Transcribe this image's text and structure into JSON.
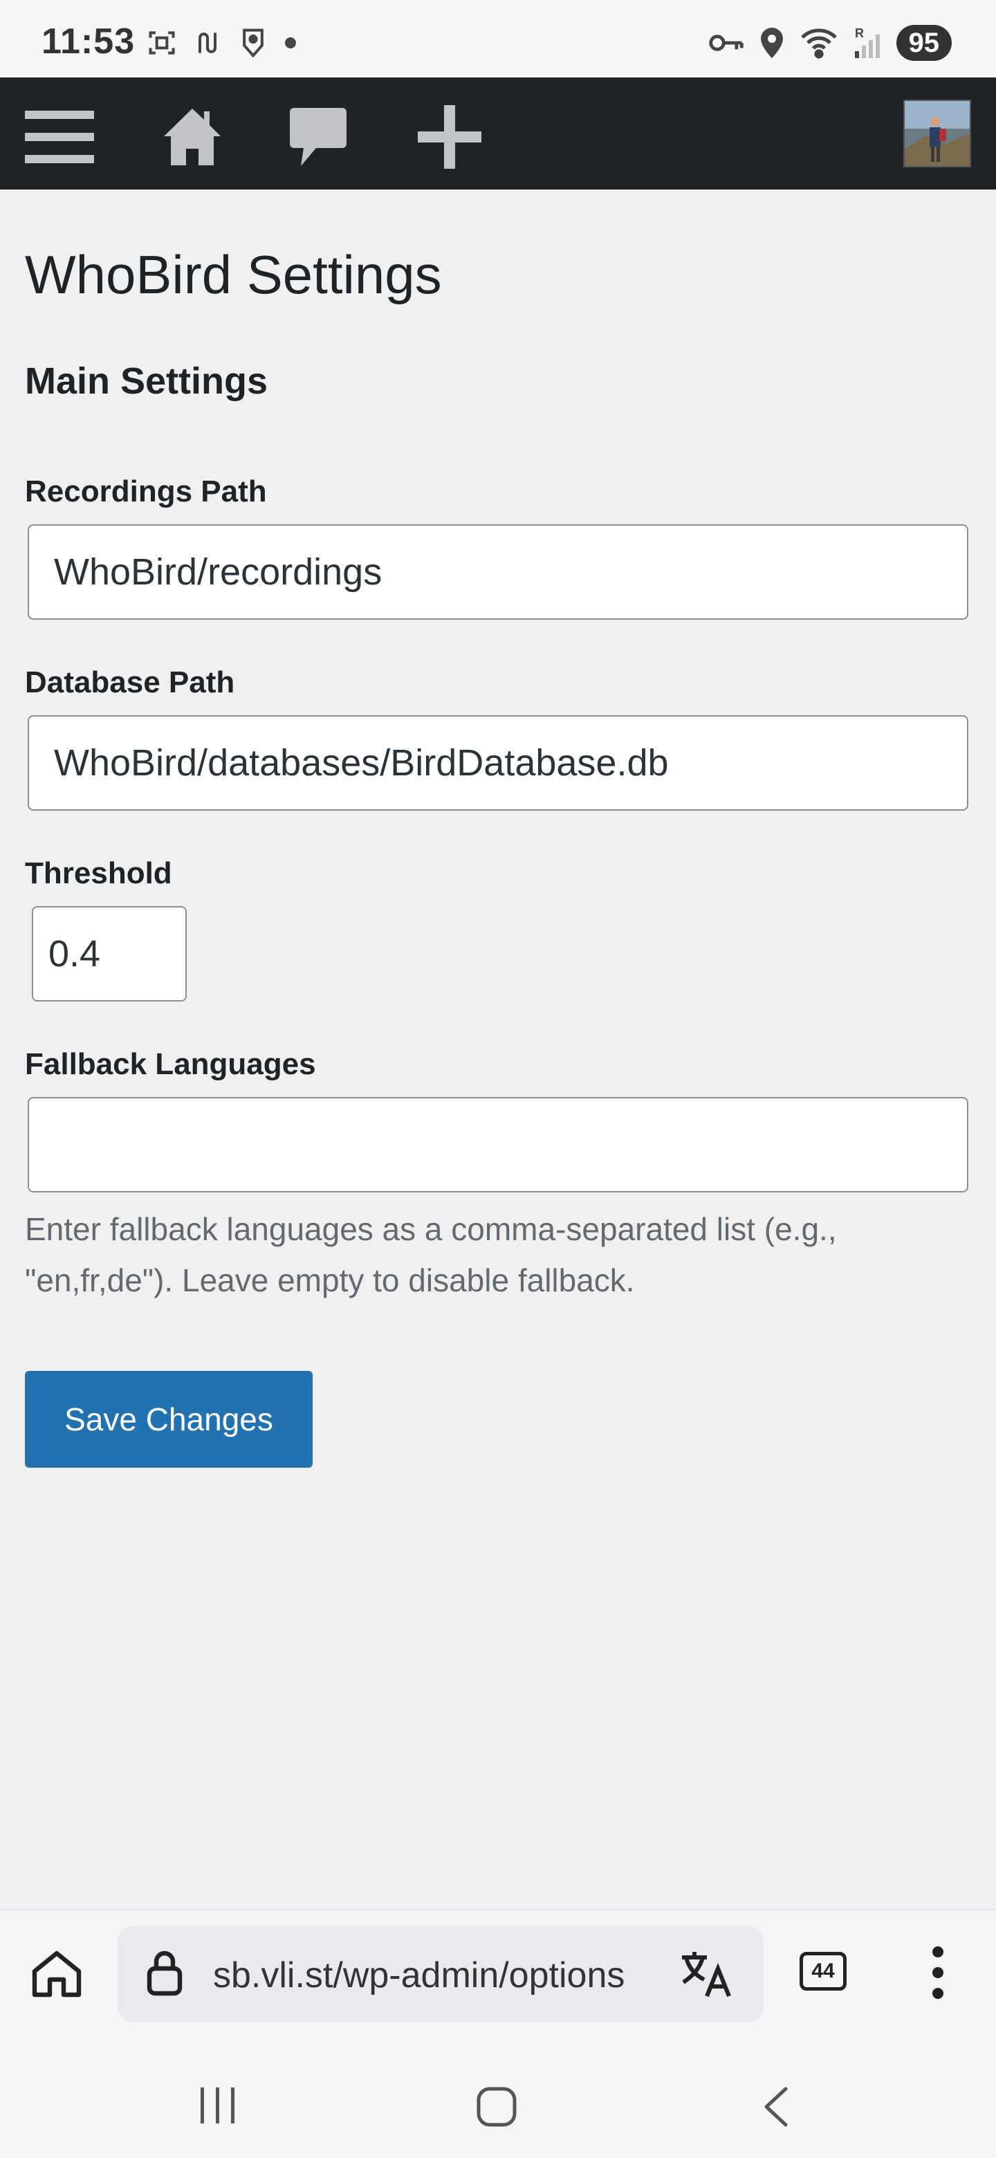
{
  "status_bar": {
    "time": "11:53",
    "battery": "95",
    "left_icons": [
      "screenshot-icon",
      "route-icon",
      "shield-location-icon",
      "dot-icon"
    ],
    "right_icons": [
      "key-icon",
      "location-icon",
      "wifi-icon",
      "signal-icon"
    ]
  },
  "admin_bar": {
    "icons": [
      "menu-icon",
      "home-icon",
      "comment-icon",
      "plus-icon"
    ],
    "avatar": "user-avatar"
  },
  "page": {
    "title": "WhoBird Settings",
    "section_title": "Main Settings",
    "recordings_path": {
      "label": "Recordings Path",
      "value": "WhoBird/recordings"
    },
    "database_path": {
      "label": "Database Path",
      "value": "WhoBird/databases/BirdDatabase.db"
    },
    "threshold": {
      "label": "Threshold",
      "value": "0.4"
    },
    "fallback_languages": {
      "label": "Fallback Languages",
      "value": "",
      "description": "Enter fallback languages as a comma-separated list (e.g., \"en,fr,de\"). Leave empty to disable fallback."
    },
    "save_label": "Save Changes"
  },
  "browser": {
    "url": "sb.vli.st/wp-admin/options",
    "tab_count": "44",
    "icons": [
      "home-icon",
      "lock-icon",
      "translate-icon",
      "tabs-icon",
      "more-icon"
    ]
  },
  "nav": {
    "icons": [
      "recents-icon",
      "home-icon",
      "back-icon"
    ]
  },
  "colors": {
    "admin_bar": "#1d2327",
    "primary_button": "#2271b1",
    "page_background": "#f0f0f1"
  }
}
